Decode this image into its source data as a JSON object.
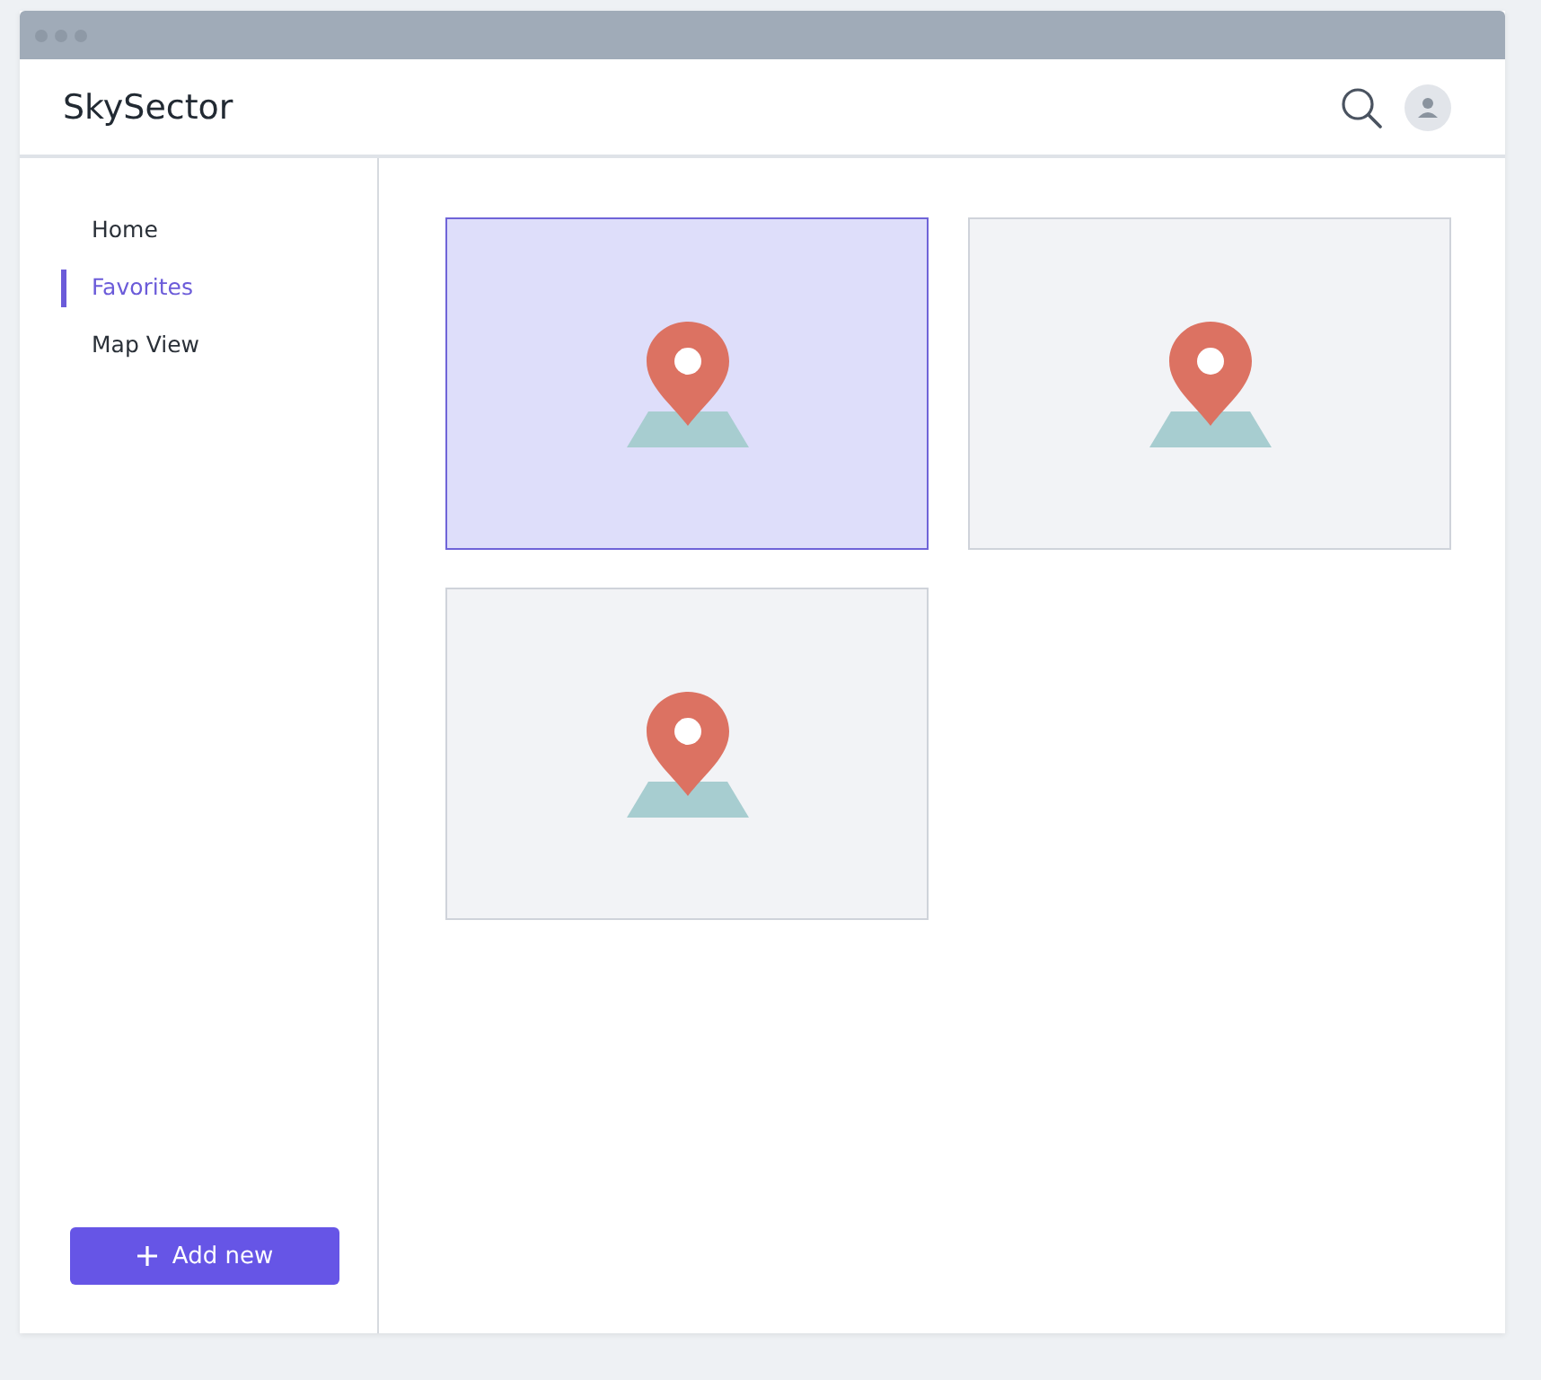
{
  "app": {
    "title": "SkySector"
  },
  "sidebar": {
    "items": [
      {
        "label": "Home",
        "selected": false
      },
      {
        "label": "Favorites",
        "selected": true
      },
      {
        "label": "Map View",
        "selected": false
      }
    ],
    "add_button": {
      "label": "Add new"
    }
  },
  "cards": [
    {
      "selected": true
    },
    {
      "selected": false
    },
    {
      "selected": false
    }
  ]
}
